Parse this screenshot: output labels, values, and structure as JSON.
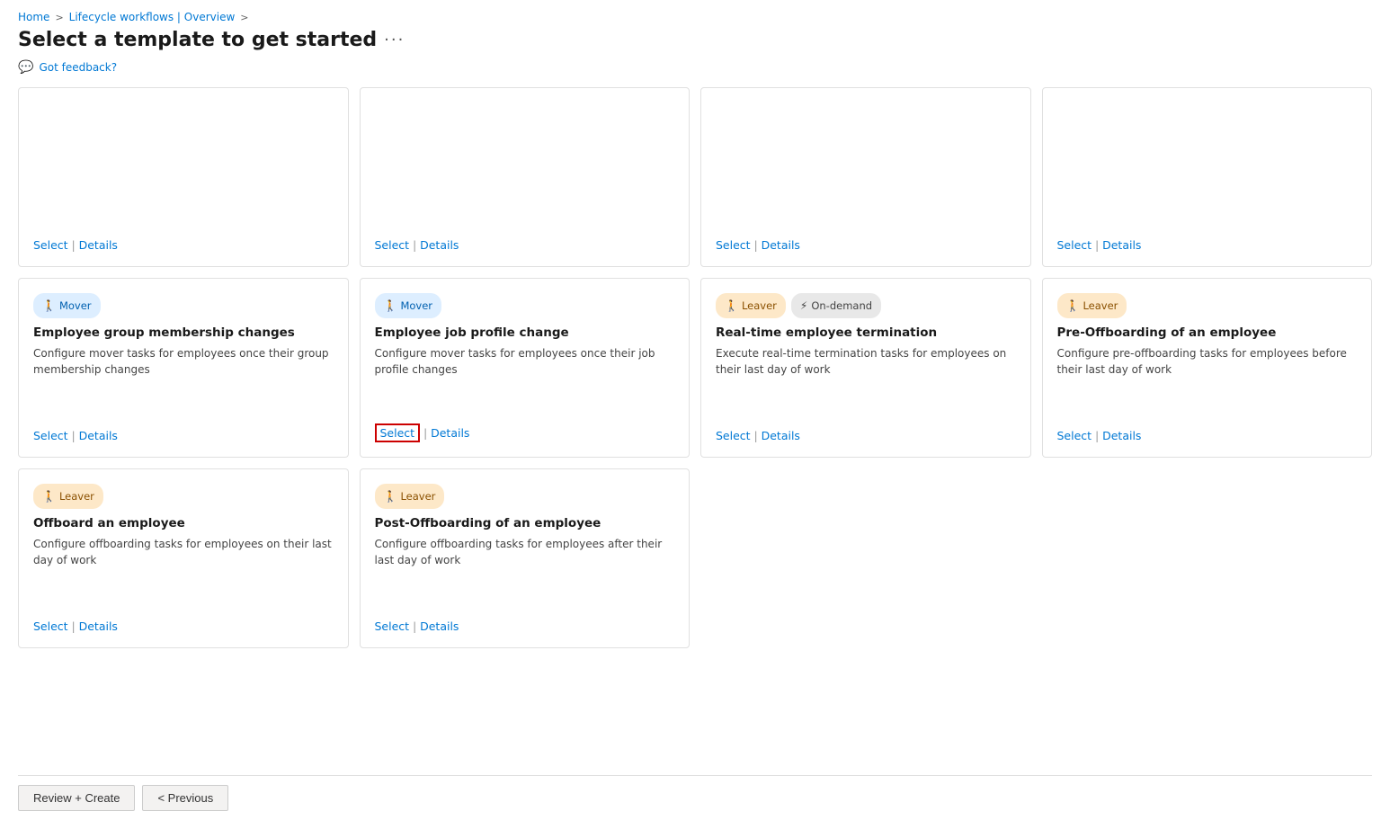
{
  "breadcrumb": {
    "home": "Home",
    "separator1": ">",
    "lifecycle": "Lifecycle workflows | Overview",
    "separator2": ">"
  },
  "page": {
    "title": "Select a template to get started",
    "more_label": "···",
    "feedback_label": "Got feedback?"
  },
  "bottom_bar": {
    "review_create_label": "Review + Create",
    "previous_label": "< Previous"
  },
  "cards": [
    {
      "id": "card-1",
      "badges": [],
      "title": "",
      "description": "",
      "select_label": "Select",
      "details_label": "Details",
      "highlighted": false
    },
    {
      "id": "card-2",
      "badges": [],
      "title": "",
      "description": "",
      "select_label": "Select",
      "details_label": "Details",
      "highlighted": false
    },
    {
      "id": "card-3",
      "badges": [],
      "title": "",
      "description": "",
      "select_label": "Select",
      "details_label": "Details",
      "highlighted": false
    },
    {
      "id": "card-4",
      "badges": [],
      "title": "",
      "description": "",
      "select_label": "Select",
      "details_label": "Details",
      "highlighted": false
    },
    {
      "id": "card-5",
      "badges": [
        {
          "type": "mover",
          "icon": "👤",
          "label": "Mover"
        }
      ],
      "title": "Employee group membership changes",
      "description": "Configure mover tasks for employees once their group membership changes",
      "select_label": "Select",
      "details_label": "Details",
      "highlighted": false
    },
    {
      "id": "card-6",
      "badges": [
        {
          "type": "mover",
          "icon": "👤",
          "label": "Mover"
        }
      ],
      "title": "Employee job profile change",
      "description": "Configure mover tasks for employees once their job profile changes",
      "select_label": "Select",
      "details_label": "Details",
      "highlighted": true
    },
    {
      "id": "card-7",
      "badges": [
        {
          "type": "leaver",
          "icon": "👤",
          "label": "Leaver"
        },
        {
          "type": "ondemand",
          "icon": "⚡",
          "label": "On-demand"
        }
      ],
      "title": "Real-time employee termination",
      "description": "Execute real-time termination tasks for employees on their last day of work",
      "select_label": "Select",
      "details_label": "Details",
      "highlighted": false
    },
    {
      "id": "card-8",
      "badges": [
        {
          "type": "leaver",
          "icon": "👤",
          "label": "Leaver"
        }
      ],
      "title": "Pre-Offboarding of an employee",
      "description": "Configure pre-offboarding tasks for employees before their last day of work",
      "select_label": "Select",
      "details_label": "Details",
      "highlighted": false
    },
    {
      "id": "card-9",
      "badges": [
        {
          "type": "leaver",
          "icon": "👤",
          "label": "Leaver"
        }
      ],
      "title": "Offboard an employee",
      "description": "Configure offboarding tasks for employees on their last day of work",
      "select_label": "Select",
      "details_label": "Details",
      "highlighted": false
    },
    {
      "id": "card-10",
      "badges": [
        {
          "type": "leaver",
          "icon": "👤",
          "label": "Leaver"
        }
      ],
      "title": "Post-Offboarding of an employee",
      "description": "Configure offboarding tasks for employees after their last day of work",
      "select_label": "Select",
      "details_label": "Details",
      "highlighted": false
    }
  ]
}
